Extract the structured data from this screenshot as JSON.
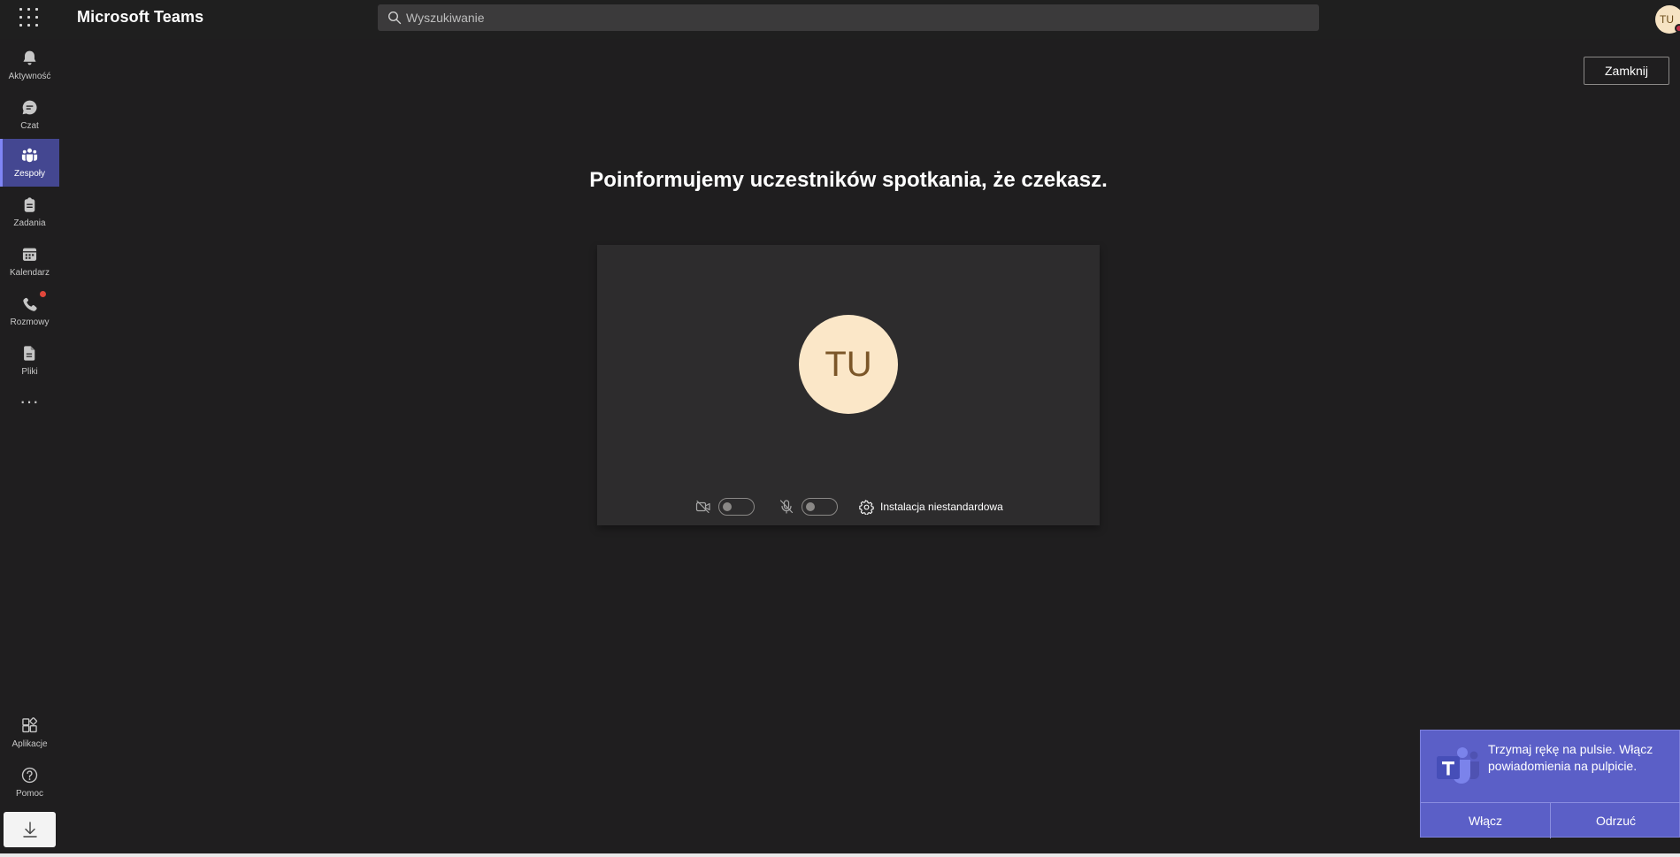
{
  "app": {
    "title": "Microsoft Teams"
  },
  "search": {
    "placeholder": "Wyszukiwanie"
  },
  "user": {
    "initials": "TU"
  },
  "rail": {
    "items": [
      {
        "label": "Aktywność",
        "icon": "bell-icon"
      },
      {
        "label": "Czat",
        "icon": "chat-icon"
      },
      {
        "label": "Zespoły",
        "icon": "teams-icon",
        "active": true
      },
      {
        "label": "Zadania",
        "icon": "tasks-icon"
      },
      {
        "label": "Kalendarz",
        "icon": "calendar-icon"
      },
      {
        "label": "Rozmowy",
        "icon": "phone-icon",
        "badge": true
      },
      {
        "label": "Pliki",
        "icon": "file-icon"
      }
    ],
    "more": "···",
    "bottom": [
      {
        "label": "Aplikacje",
        "icon": "apps-icon"
      },
      {
        "label": "Pomoc",
        "icon": "help-icon"
      }
    ]
  },
  "main": {
    "close_label": "Zamknij",
    "title": "Poinformujemy uczestników spotkania, że czekasz.",
    "preview": {
      "avatar_initials": "TU",
      "camera_on": false,
      "mic_on": false,
      "settings_label": "Instalacja niestandardowa"
    }
  },
  "toast": {
    "message": "Trzymaj rękę na pulsie. Włącz powiadomienia na pulpicie.",
    "accept_label": "Włącz",
    "dismiss_label": "Odrzuć"
  },
  "colors": {
    "accent": "#444791",
    "toast": "#5b5fc7",
    "background": "#1f1e1f",
    "avatar": "#fbe7c8"
  }
}
